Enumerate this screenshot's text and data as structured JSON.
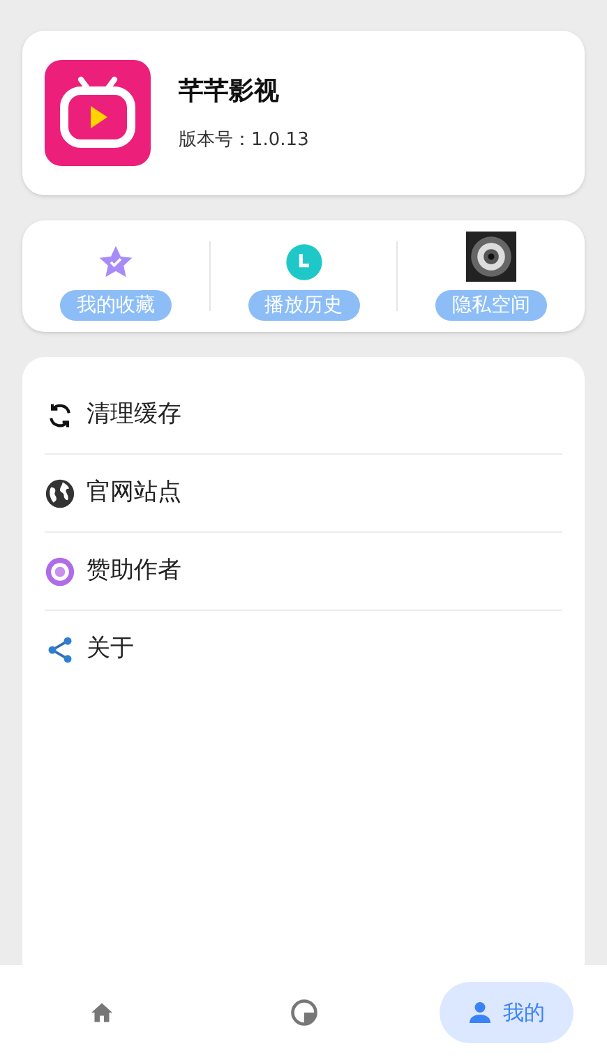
{
  "app": {
    "name": "芊芊影视",
    "version": "版本号：1.0.13"
  },
  "shortcuts": [
    {
      "label": "我的收藏"
    },
    {
      "label": "播放历史"
    },
    {
      "label": "隐私空间"
    }
  ],
  "menu": [
    {
      "label": "清理缓存"
    },
    {
      "label": "官网站点"
    },
    {
      "label": "赞助作者"
    },
    {
      "label": "关于"
    }
  ],
  "nav": [
    {
      "selected": false
    },
    {
      "selected": false
    },
    {
      "label": "我的",
      "selected": true
    }
  ]
}
